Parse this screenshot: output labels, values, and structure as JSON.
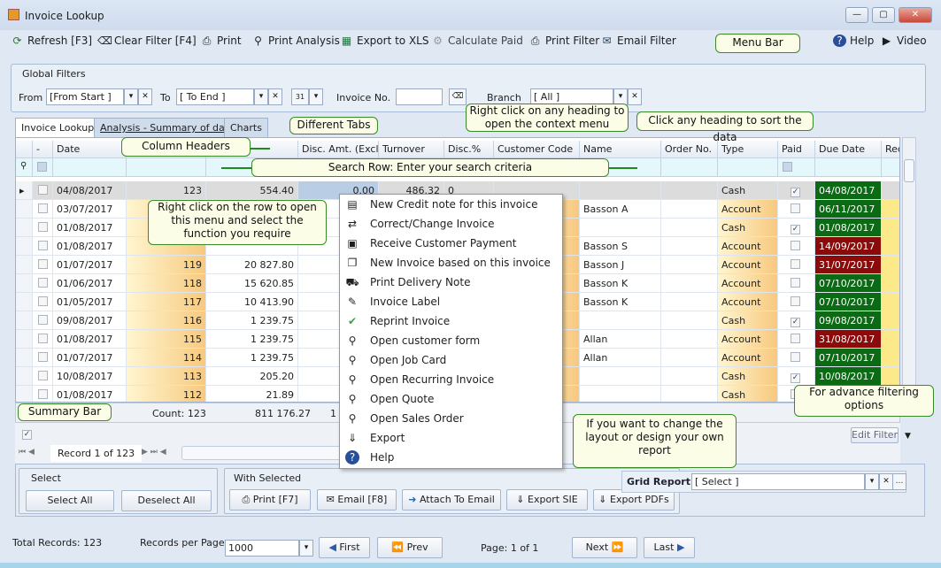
{
  "window": {
    "title": "Invoice Lookup",
    "controls": [
      "—",
      "▢",
      "✕"
    ]
  },
  "toolbar": {
    "refresh": "Refresh [F3]",
    "clear_filter": "Clear Filter [F4]",
    "print": "Print",
    "print_analysis": "Print Analysis",
    "export_xls": "Export to XLS",
    "calculate_paid": "Calculate Paid",
    "print_filter": "Print Filter",
    "email_filter": "Email Filter",
    "help": "Help",
    "video": "Video"
  },
  "callouts": {
    "menu_bar": "Menu Bar",
    "tabs": "Different Tabs",
    "context": "Right click on any heading to open the context menu",
    "sort": "Click any heading to sort the data",
    "headers": "Column Headers",
    "search": "Search Row: Enter your search criteria",
    "row_menu": "Right click on the row to open this menu and select the function you require",
    "summary": "Summary Bar",
    "advance": "For advance filtering options",
    "layout": "If you want to change the layout or design your own report"
  },
  "filters": {
    "title": "Global Filters",
    "from_label": "From",
    "from_value": "[From Start ]",
    "to_label": "To",
    "to_value": "[ To End ]",
    "invoice_label": "Invoice No.",
    "invoice_value": "",
    "branch_label": "Branch",
    "branch_value": "[ All ]",
    "calendar": "31"
  },
  "tabs": [
    {
      "label": "Invoice Lookup",
      "active": true
    },
    {
      "label": "Analysis - Summary of data"
    },
    {
      "label": "Charts"
    }
  ],
  "columns": [
    "-",
    "Date",
    "",
    "",
    "Disc. Amt. (Excl)",
    "Turnover",
    "Disc.%",
    "Customer Code",
    "Name",
    "Order No.",
    "Type",
    "Paid",
    "Due Date",
    "Rec"
  ],
  "rows": [
    {
      "date": "04/08/2017",
      "inv": "123",
      "amount": "554.40",
      "disc": "0.00",
      "turnover": "486.32",
      "discp": "0",
      "name": "",
      "type": "Cash",
      "paid": true,
      "due": "04/08/2017",
      "status": "ok"
    },
    {
      "date": "03/07/2017",
      "inv": "",
      "amount": "",
      "name": "Basson A",
      "type": "Account",
      "paid": false,
      "due": "06/11/2017",
      "status": "ok"
    },
    {
      "date": "01/08/2017",
      "inv": "",
      "amount": "",
      "name": "",
      "type": "Cash",
      "paid": true,
      "due": "01/08/2017",
      "status": "ok"
    },
    {
      "date": "01/08/2017",
      "inv": "",
      "amount": "",
      "name": "Basson S",
      "type": "Account",
      "paid": false,
      "due": "14/09/2017",
      "status": "overdue"
    },
    {
      "date": "01/07/2017",
      "inv": "119",
      "amount": "20 827.80",
      "name": "Basson J",
      "type": "Account",
      "paid": false,
      "due": "31/07/2017",
      "status": "overdue"
    },
    {
      "date": "01/06/2017",
      "inv": "118",
      "amount": "15 620.85",
      "name": "Basson K",
      "type": "Account",
      "paid": false,
      "due": "07/10/2017",
      "status": "ok"
    },
    {
      "date": "01/05/2017",
      "inv": "117",
      "amount": "10 413.90",
      "name": "Basson K",
      "type": "Account",
      "paid": false,
      "due": "07/10/2017",
      "status": "ok"
    },
    {
      "date": "09/08/2017",
      "inv": "116",
      "amount": "1 239.75",
      "name": "",
      "type": "Cash",
      "paid": true,
      "due": "09/08/2017",
      "status": "ok"
    },
    {
      "date": "01/08/2017",
      "inv": "115",
      "amount": "1 239.75",
      "name": "Allan",
      "type": "Account",
      "paid": false,
      "due": "31/08/2017",
      "status": "overdue"
    },
    {
      "date": "01/07/2017",
      "inv": "114",
      "amount": "1 239.75",
      "name": "Allan",
      "type": "Account",
      "paid": false,
      "due": "07/10/2017",
      "status": "ok"
    },
    {
      "date": "10/08/2017",
      "inv": "113",
      "amount": "205.20",
      "name": "",
      "type": "Cash",
      "paid": true,
      "due": "10/08/2017",
      "status": "ok"
    },
    {
      "date": "01/08/2017",
      "inv": "112",
      "amount": "21.89",
      "name": "",
      "type": "Cash",
      "paid": false,
      "due": "",
      "status": "ok"
    }
  ],
  "summary": {
    "count": "Count: 123",
    "amount": "811 176.27",
    "disc": "1"
  },
  "context_menu": [
    {
      "label": "New Credit note for this invoice",
      "icon": "credit-note-icon",
      "g": "▤"
    },
    {
      "label": "Correct/Change Invoice",
      "icon": "change-icon",
      "g": "⇄"
    },
    {
      "label": "Receive Customer Payment",
      "icon": "payment-icon",
      "g": "▣"
    },
    {
      "label": "New Invoice based on this invoice",
      "icon": "copy-icon",
      "g": "❐"
    },
    {
      "label": "Print Delivery Note",
      "icon": "truck-icon",
      "g": "⛟"
    },
    {
      "label": "Invoice Label",
      "icon": "label-icon",
      "g": "✎"
    },
    {
      "label": "Reprint Invoice",
      "icon": "check-icon",
      "g": "✔"
    },
    {
      "label": "Open customer form",
      "icon": "search-icon",
      "g": "⚲"
    },
    {
      "label": "Open Job Card",
      "icon": "search-icon",
      "g": "⚲"
    },
    {
      "label": "Open Recurring Invoice",
      "icon": "search-icon",
      "g": "⚲"
    },
    {
      "label": "Open Quote",
      "icon": "search-icon",
      "g": "⚲"
    },
    {
      "label": "Open Sales Order",
      "icon": "search-icon",
      "g": "⚲"
    },
    {
      "label": "Export",
      "icon": "export-icon",
      "g": "⇓"
    },
    {
      "label": "Help",
      "icon": "help-icon",
      "g": "?"
    }
  ],
  "grid_footer": {
    "edit_filter": "Edit Filter",
    "record": "Record 1 of 123"
  },
  "select_group": {
    "title": "Select",
    "select_all": "Select All",
    "deselect_all": "Deselect All"
  },
  "with_selected": {
    "title": "With Selected",
    "print": "Print [F7]",
    "email": "Email [F8]",
    "attach": "Attach To Email",
    "export_sie": "Export SIE",
    "export_pdfs": "Export PDFs"
  },
  "grid_report": {
    "label": "Grid Report:",
    "value": "[ Select ]"
  },
  "pager": {
    "total": "Total Records: 123",
    "per_page_label": "Records per Page:",
    "per_page": "1000",
    "first": "First",
    "prev": "Prev",
    "page": "Page: 1 of 1",
    "next": "Next",
    "last": "Last"
  },
  "colors": {
    "due_ok": "#0b6b14",
    "due_overdue": "#8b0a0a",
    "highlight": "#fcd98a",
    "accent_border": "#3a8a2a"
  }
}
